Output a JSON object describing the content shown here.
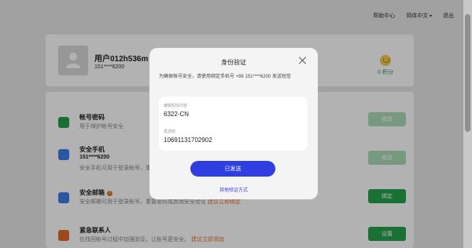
{
  "topnav": {
    "help": "帮助中心",
    "language": "简体中文",
    "logout": "退出"
  },
  "profile": {
    "username": "用户012h536m",
    "phone": "151****6200",
    "points": "0 积分"
  },
  "sections": [
    {
      "title": "帐号密码",
      "desc": "用于保护帐号安全",
      "button": "修改",
      "icon_color": "#27a04b"
    },
    {
      "title": "安全手机",
      "value": "151****6200",
      "desc": "安全手机可用于登录帐号，重置密码或其他安全验证",
      "button": "修改",
      "icon_color": "#3b7ee8"
    },
    {
      "title": "安全邮箱",
      "desc": "安全邮箱可用于登录帐号，重置密码或其他安全验证",
      "link": "建议立即绑定",
      "button": "绑定",
      "icon_color": "#3b7ee8"
    },
    {
      "title": "紧急联系人",
      "desc": "在找回帐号过程中加强验证，让帐号更安全。",
      "link": "建议立即添加",
      "button": "设置",
      "icon_color": "#e06a2a"
    }
  ],
  "modal": {
    "title": "身份验证",
    "notice": "为确保帐号安全，请使用绑定手机号 +86 151****6200 发送短信",
    "sms_label": "编辑短信内容",
    "sms_value": "6322-CN",
    "send_to_label": "发送到",
    "send_to_value": "10691131702902",
    "sent_button": "已发送",
    "other_methods": "其他验证方式"
  },
  "colors": {
    "primary": "#2f3ee0",
    "green": "#25a24a",
    "orange": "#e0742a"
  }
}
